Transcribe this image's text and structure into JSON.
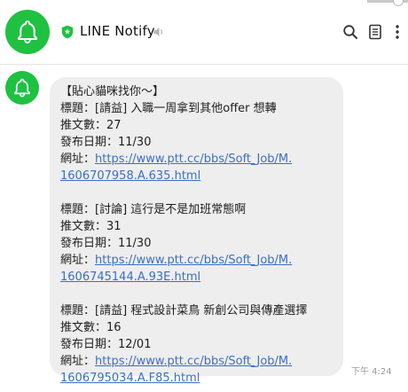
{
  "colors": {
    "brand": "#1fc140",
    "link": "#3a6fc4",
    "bubble": "#eeeeef"
  },
  "header": {
    "title": "LINE Notify",
    "icons": [
      "bell-icon",
      "shield-star-icon",
      "speaker-muted-icon",
      "search-icon",
      "notes-icon",
      "more-vertical-icon"
    ]
  },
  "message": {
    "intro": "【貼心貓咪找你～】",
    "posts": [
      {
        "title_line": "標題：[請益] 入職一周拿到其他offer 想轉",
        "count_line": "推文數：27",
        "date_line": "發布日期：11/30",
        "url_label": "網址：",
        "url_part1": "https://www.ptt.cc/bbs/Soft_Job/M.",
        "url_part2": "1606707958.A.635.html"
      },
      {
        "title_line": "標題：[討論] 這行是不是加班常態啊",
        "count_line": "推文數：31",
        "date_line": "發布日期：11/30",
        "url_label": "網址：",
        "url_part1": "https://www.ptt.cc/bbs/Soft_Job/M.",
        "url_part2": "1606745144.A.93E.html"
      },
      {
        "title_line": "標題：[請益] 程式設計菜鳥 新創公司與傳產選擇",
        "count_line": "推文數：16",
        "date_line": "發布日期：12/01",
        "url_label": "網址：",
        "url_part1": "https://www.ptt.cc/bbs/Soft_Job/M.",
        "url_part2": "1606795034.A.F85.html"
      }
    ],
    "timestamp": "下午 4:24"
  }
}
